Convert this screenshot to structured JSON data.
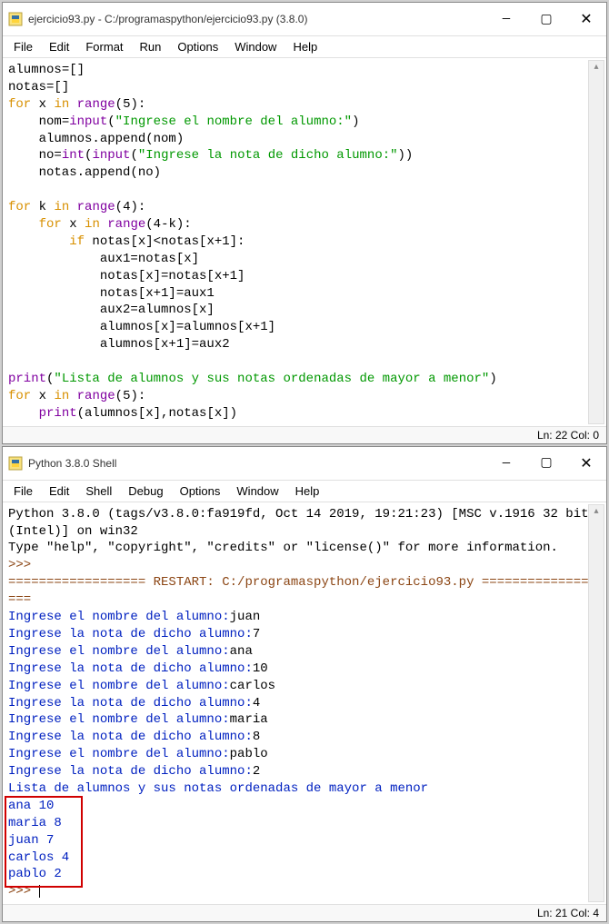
{
  "editor": {
    "title": "ejercicio93.py - C:/programaspython/ejercicio93.py (3.8.0)",
    "menu": [
      "File",
      "Edit",
      "Format",
      "Run",
      "Options",
      "Window",
      "Help"
    ],
    "win_btns": {
      "min": "—",
      "max": "▢",
      "close": "✕"
    },
    "status": "Ln: 22  Col: 0",
    "code": {
      "l1a": "alumnos",
      "l1b": "=[]",
      "l2a": "notas",
      "l2b": "=[]",
      "l3_for": "for",
      "l3_x": " x ",
      "l3_in": "in",
      "l3_range": " range",
      "l3_args": "(5):",
      "l4_pad": "    ",
      "l4_nom": "nom=",
      "l4_input": "input",
      "l4_p1": "(",
      "l4_s": "\"Ingrese el nombre del alumno:\"",
      "l4_p2": ")",
      "l5": "    alumnos.append(nom)",
      "l6_pad": "    ",
      "l6_no": "no=",
      "l6_int": "int",
      "l6_p1": "(",
      "l6_input": "input",
      "l6_p2": "(",
      "l6_s": "\"Ingrese la nota de dicho alumno:\"",
      "l6_p3": "))",
      "l7": "    notas.append(no)",
      "l9_for": "for",
      "l9_k": " k ",
      "l9_in": "in",
      "l9_range": " range",
      "l9_args": "(4):",
      "l10_pad": "    ",
      "l10_for": "for",
      "l10_x": " x ",
      "l10_in": "in",
      "l10_range": " range",
      "l10_args": "(4-k):",
      "l11_pad": "        ",
      "l11_if": "if",
      "l11_rest": " notas[x]<notas[x+1]:",
      "l12": "            aux1=notas[x]",
      "l13": "            notas[x]=notas[x+1]",
      "l14": "            notas[x+1]=aux1",
      "l15": "            aux2=alumnos[x]",
      "l16": "            alumnos[x]=alumnos[x+1]",
      "l17": "            alumnos[x+1]=aux2",
      "l19_print": "print",
      "l19_p1": "(",
      "l19_s": "\"Lista de alumnos y sus notas ordenadas de mayor a menor\"",
      "l19_p2": ")",
      "l20_for": "for",
      "l20_x": " x ",
      "l20_in": "in",
      "l20_range": " range",
      "l20_args": "(5):",
      "l21_pad": "    ",
      "l21_print": "print",
      "l21_args": "(alumnos[x],notas[x])"
    }
  },
  "shell": {
    "title": "Python 3.8.0 Shell",
    "menu": [
      "File",
      "Edit",
      "Shell",
      "Debug",
      "Options",
      "Window",
      "Help"
    ],
    "win_btns": {
      "min": "—",
      "max": "▢",
      "close": "✕"
    },
    "status": "Ln: 21  Col: 4",
    "header1": "Python 3.8.0 (tags/v3.8.0:fa919fd, Oct 14 2019, 19:21:23) [MSC v.1916 32 bit (Intel)] on win32",
    "header2": "Type \"help\", \"copyright\", \"credits\" or \"license()\" for more information.",
    "prompt": ">>>",
    "restart": "================== RESTART: C:/programaspython/ejercicio93.py ==================",
    "lines": [
      {
        "p": "Ingrese el nombre del alumno:",
        "u": "juan"
      },
      {
        "p": "Ingrese la nota de dicho alumno:",
        "u": "7"
      },
      {
        "p": "Ingrese el nombre del alumno:",
        "u": "ana"
      },
      {
        "p": "Ingrese la nota de dicho alumno:",
        "u": "10"
      },
      {
        "p": "Ingrese el nombre del alumno:",
        "u": "carlos"
      },
      {
        "p": "Ingrese la nota de dicho alumno:",
        "u": "4"
      },
      {
        "p": "Ingrese el nombre del alumno:",
        "u": "maria"
      },
      {
        "p": "Ingrese la nota de dicho alumno:",
        "u": "8"
      },
      {
        "p": "Ingrese el nombre del alumno:",
        "u": "pablo"
      },
      {
        "p": "Ingrese la nota de dicho alumno:",
        "u": "2"
      }
    ],
    "out_header": "Lista de alumnos y sus notas ordenadas de mayor a menor",
    "results": [
      "ana 10",
      "maria 8",
      "juan 7",
      "carlos 4",
      "pablo 2"
    ]
  },
  "chart_data": {
    "type": "table",
    "title": "Lista de alumnos y sus notas ordenadas de mayor a menor",
    "categories": [
      "ana",
      "maria",
      "juan",
      "carlos",
      "pablo"
    ],
    "values": [
      10,
      8,
      7,
      4,
      2
    ]
  }
}
